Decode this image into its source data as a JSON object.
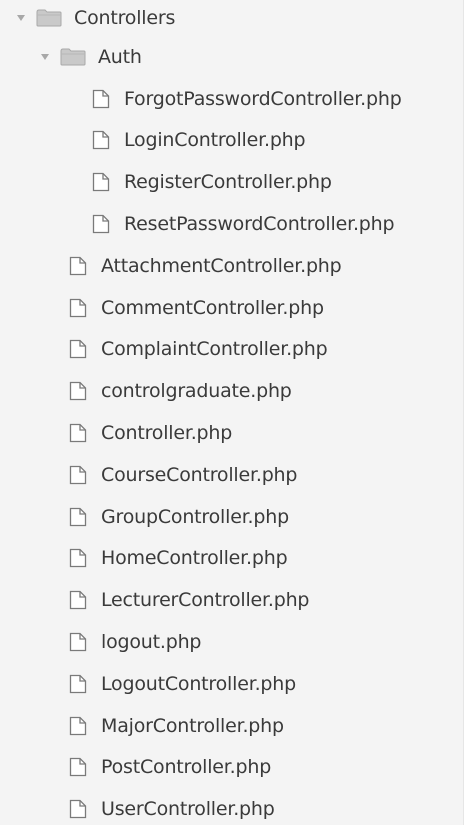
{
  "tree": {
    "root": {
      "label": "Controllers",
      "icon": "folder-icon",
      "expanded": true
    },
    "auth": {
      "label": "Auth",
      "icon": "folder-icon",
      "expanded": true,
      "files": [
        "ForgotPasswordController.php",
        "LoginController.php",
        "RegisterController.php",
        "ResetPasswordController.php"
      ]
    },
    "files": [
      "AttachmentController.php",
      "CommentController.php",
      "ComplaintController.php",
      "controlgraduate.php",
      "Controller.php",
      "CourseController.php",
      "GroupController.php",
      "HomeController.php",
      "LecturerController.php",
      "logout.php",
      "LogoutController.php",
      "MajorController.php",
      "PostController.php",
      "UserController.php"
    ]
  },
  "colors": {
    "panel_background": "#f4f4f4",
    "text": "#3a3a3a",
    "icon_stroke": "#7a7a7a",
    "folder_fill": "#c9c9c9"
  }
}
